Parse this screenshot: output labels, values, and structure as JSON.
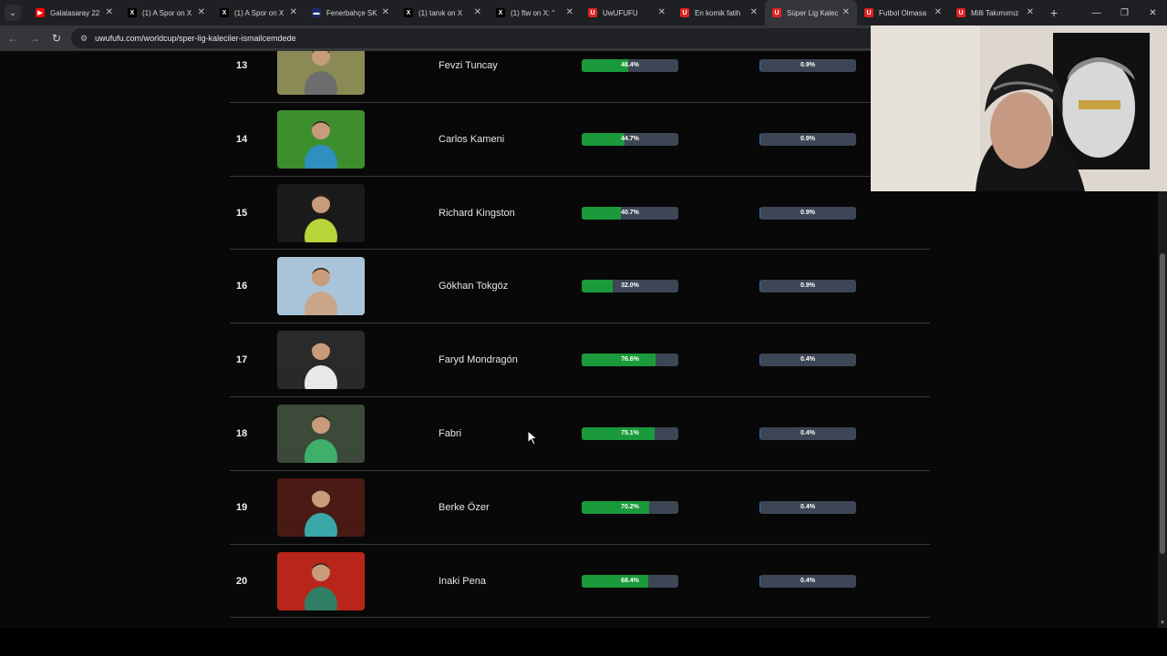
{
  "tabs": [
    {
      "title": "Galatasaray 22",
      "icon": "youtube-icon",
      "color": "#ff0000",
      "glyph": "▶"
    },
    {
      "title": "(1) A Spor on X",
      "icon": "x-icon",
      "color": "#000000",
      "glyph": "X"
    },
    {
      "title": "(1) A Spor on X",
      "icon": "x-icon",
      "color": "#000000",
      "glyph": "X"
    },
    {
      "title": "Fenerbahçe SK",
      "icon": "fenerbahce-icon",
      "color": "#1b2a6b",
      "glyph": "▬"
    },
    {
      "title": "(1) tanık on X",
      "icon": "x-icon",
      "color": "#000000",
      "glyph": "X"
    },
    {
      "title": "(1) ftw on X: \"",
      "icon": "x-icon",
      "color": "#000000",
      "glyph": "X"
    },
    {
      "title": "UwUFUFU",
      "icon": "uwufufu-icon",
      "color": "#e02424",
      "glyph": "U"
    },
    {
      "title": "En komik fatih",
      "icon": "uwufufu-icon",
      "color": "#e02424",
      "glyph": "U"
    },
    {
      "title": "Süper Lig Kalec",
      "icon": "uwufufu-icon",
      "color": "#e02424",
      "glyph": "U",
      "active": true
    },
    {
      "title": "Futbol Olmasa",
      "icon": "uwufufu-icon",
      "color": "#e02424",
      "glyph": "U"
    },
    {
      "title": "Milli Takımımız",
      "icon": "uwufufu-icon",
      "color": "#e02424",
      "glyph": "U"
    }
  ],
  "address_bar": {
    "url": "uwufufu.com/worldcup/sper-lig-kaleciler-ismailcemdede"
  },
  "ranking": [
    {
      "rank": "13",
      "name": "Fevzi Tuncay",
      "win_rate": "48.4%",
      "win_value": 48.4,
      "champion_rate": "0.9%",
      "champion_value": 0.9,
      "photo": "fevzi-tuncay-photo",
      "bg": "#8a8a55",
      "kit": "#6d6d6d"
    },
    {
      "rank": "14",
      "name": "Carlos Kameni",
      "win_rate": "44.7%",
      "win_value": 44.7,
      "champion_rate": "0.9%",
      "champion_value": 0.9,
      "photo": "carlos-kameni-photo",
      "bg": "#3d8f2e",
      "kit": "#2f8fbf"
    },
    {
      "rank": "15",
      "name": "Richard Kingston",
      "win_rate": "40.7%",
      "win_value": 40.7,
      "champion_rate": "0.9%",
      "champion_value": 0.9,
      "photo": "richard-kingston-photo",
      "bg": "#1a1a1a",
      "kit": "#b6d63a"
    },
    {
      "rank": "16",
      "name": "Gökhan Tokgöz",
      "win_rate": "32.0%",
      "win_value": 32.0,
      "champion_rate": "0.9%",
      "champion_value": 0.9,
      "photo": "gokhan-tokgoz-photo",
      "bg": "#a9c4d8",
      "kit": "#c9a58a"
    },
    {
      "rank": "17",
      "name": "Faryd Mondragón",
      "win_rate": "76.6%",
      "win_value": 76.6,
      "champion_rate": "0.4%",
      "champion_value": 0.4,
      "photo": "faryd-mondragon-photo",
      "bg": "#2a2a2a",
      "kit": "#e8e8e8"
    },
    {
      "rank": "18",
      "name": "Fabri",
      "win_rate": "75.1%",
      "win_value": 75.1,
      "champion_rate": "0.4%",
      "champion_value": 0.4,
      "photo": "fabri-photo",
      "bg": "#3c4a3a",
      "kit": "#3fb06a"
    },
    {
      "rank": "19",
      "name": "Berke Özer",
      "win_rate": "70.2%",
      "win_value": 70.2,
      "champion_rate": "0.4%",
      "champion_value": 0.4,
      "photo": "berke-ozer-photo",
      "bg": "#4a1a14",
      "kit": "#3aa7a8"
    },
    {
      "rank": "20",
      "name": "Inaki Pena",
      "win_rate": "68.4%",
      "win_value": 68.4,
      "champion_rate": "0.4%",
      "champion_value": 0.4,
      "photo": "inaki-pena-photo",
      "bg": "#b8261b",
      "kit": "#2f7f66"
    }
  ],
  "colors": {
    "win_bar": "#1a9a3a",
    "champion_bar": "#3366cc",
    "bar_track": "#3d4654"
  }
}
